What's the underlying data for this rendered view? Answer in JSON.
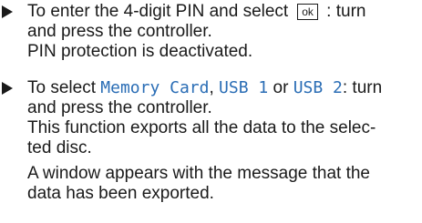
{
  "steps": [
    {
      "lines": [
        {
          "before": "To enter the 4-digit PIN and select",
          "button": "ok",
          "after": " : turn"
        },
        "and press the controller.",
        "PIN protection is deactivated."
      ]
    },
    {
      "line1": {
        "prefix": "To select ",
        "opt1": "Memory Card",
        "sep1": ", ",
        "opt2": "USB 1",
        "sep2": " or ",
        "opt3": "USB 2",
        "suffix": ": turn"
      },
      "line2": "and press the controller.",
      "line3": "This function exports all the data to the selec-",
      "line4": "ted disc.",
      "line5": "A window appears with the message that the",
      "line6": "data has been exported."
    }
  ],
  "colors": {
    "text": "#1a1a1a",
    "menu_text": "#2a6db5"
  },
  "icons": {
    "bullet": "right-triangle-bullet-icon"
  }
}
